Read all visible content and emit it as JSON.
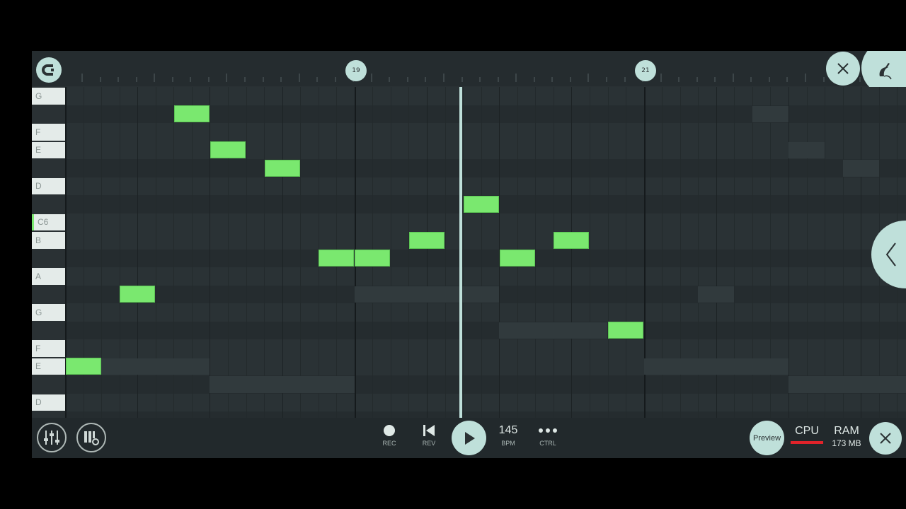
{
  "ruler": {
    "markers": [
      "19",
      "21"
    ]
  },
  "keys": [
    {
      "label": "G",
      "row": 0
    },
    {
      "label": "F",
      "row": 2
    },
    {
      "label": "E",
      "row": 3
    },
    {
      "label": "D",
      "row": 5
    },
    {
      "label": "C6",
      "row": 7,
      "highlight": true
    },
    {
      "label": "B",
      "row": 8
    },
    {
      "label": "A",
      "row": 10
    },
    {
      "label": "G",
      "row": 12
    },
    {
      "label": "F",
      "row": 14
    },
    {
      "label": "E",
      "row": 15
    },
    {
      "label": "D",
      "row": 17
    }
  ],
  "notes": [
    {
      "row": 15,
      "start": 0,
      "len": 2
    },
    {
      "row": 11,
      "start": 3,
      "len": 2
    },
    {
      "row": 1,
      "start": 6,
      "len": 2
    },
    {
      "row": 3,
      "start": 8,
      "len": 2
    },
    {
      "row": 4,
      "start": 11,
      "len": 2
    },
    {
      "row": 9,
      "start": 14,
      "len": 2
    },
    {
      "row": 9,
      "start": 16,
      "len": 2
    },
    {
      "row": 8,
      "start": 19,
      "len": 2
    },
    {
      "row": 6,
      "start": 22,
      "len": 2
    },
    {
      "row": 9,
      "start": 24,
      "len": 2
    },
    {
      "row": 8,
      "start": 27,
      "len": 2
    },
    {
      "row": 13,
      "start": 30,
      "len": 2
    }
  ],
  "transport": {
    "rec_label": "REC",
    "rev_label": "REV",
    "bpm_value": "145",
    "bpm_label": "BPM",
    "ctrl_label": "CTRL"
  },
  "status": {
    "preview_label": "Preview",
    "cpu_label": "CPU",
    "ram_label": "RAM",
    "ram_value": "173 MB"
  },
  "colors": {
    "note": "#7ae86f",
    "accent": "#bfe0da",
    "cpu_bar": "#e0232a"
  }
}
